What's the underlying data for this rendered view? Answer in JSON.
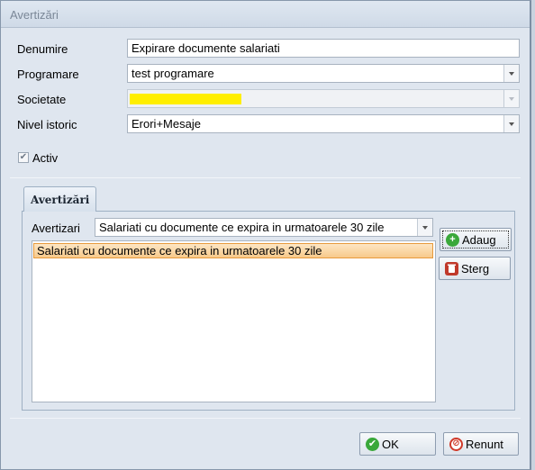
{
  "window": {
    "title": "Avertizări"
  },
  "form": {
    "denumire": {
      "label": "Denumire",
      "value": "Expirare documente salariati"
    },
    "programare": {
      "label": "Programare",
      "value": "test programare"
    },
    "societate": {
      "label": "Societate",
      "value": ""
    },
    "nivel_istoric": {
      "label": "Nivel istoric",
      "value": "Erori+Mesaje"
    },
    "activ": {
      "label": "Activ",
      "checked": true
    }
  },
  "tabs": [
    {
      "label": "Avertizări",
      "active": true
    }
  ],
  "avertizari_panel": {
    "combo_label": "Avertizari",
    "combo_value": "Salariati cu documente ce expira in urmatoarele 30 zile",
    "list_items": [
      {
        "text": "Salariati cu documente ce expira in urmatoarele 30 zile",
        "selected": true
      }
    ],
    "add_label": "Adaug",
    "delete_label": "Sterg"
  },
  "footer": {
    "ok_label": "OK",
    "cancel_label": "Renunt"
  },
  "colors": {
    "window_bg": "#dfe6ef",
    "selection": "#f7c98a",
    "redacted_highlight": "#ffee00",
    "add_icon": "#3aa83a",
    "delete_icon": "#c0392b",
    "ok_icon": "#3aa83a",
    "cancel_icon": "#d03a2a"
  },
  "icons": {
    "add": "plus-icon",
    "delete": "trash-icon",
    "ok": "checkmark-icon",
    "cancel": "cancel-icon",
    "dropdown": "chevron-down-icon"
  }
}
